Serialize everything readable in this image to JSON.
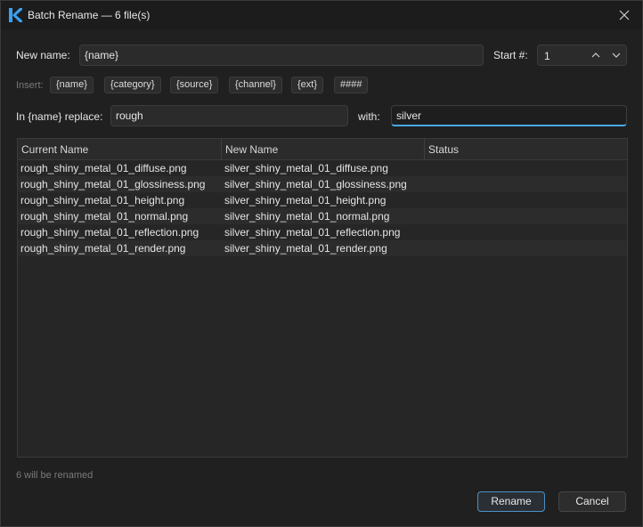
{
  "window": {
    "title": "Batch Rename — 6 file(s)"
  },
  "new_name": {
    "label": "New name:",
    "value": "{name}"
  },
  "start": {
    "label": "Start #:",
    "value": "1"
  },
  "insert": {
    "label": "Insert:",
    "tokens": [
      "{name}",
      "{category}",
      "{source}",
      "{channel}",
      "{ext}",
      "####"
    ]
  },
  "replace": {
    "label": "In {name} replace:",
    "value": "rough",
    "with_label": "with:",
    "with_value": "silver"
  },
  "table": {
    "columns": [
      "Current Name",
      "New Name",
      "Status"
    ],
    "rows": [
      {
        "current": "rough_shiny_metal_01_diffuse.png",
        "new": "silver_shiny_metal_01_diffuse.png",
        "status": ""
      },
      {
        "current": "rough_shiny_metal_01_glossiness.png",
        "new": "silver_shiny_metal_01_glossiness.png",
        "status": ""
      },
      {
        "current": "rough_shiny_metal_01_height.png",
        "new": "silver_shiny_metal_01_height.png",
        "status": ""
      },
      {
        "current": "rough_shiny_metal_01_normal.png",
        "new": "silver_shiny_metal_01_normal.png",
        "status": ""
      },
      {
        "current": "rough_shiny_metal_01_reflection.png",
        "new": "silver_shiny_metal_01_reflection.png",
        "status": ""
      },
      {
        "current": "rough_shiny_metal_01_render.png",
        "new": "silver_shiny_metal_01_render.png",
        "status": ""
      }
    ]
  },
  "footer": {
    "note": "6 will be renamed",
    "rename_label": "Rename",
    "cancel_label": "Cancel"
  },
  "colors": {
    "accent": "#4aa8e8",
    "background": "#202020",
    "app_icon": "#3aa0f0"
  }
}
